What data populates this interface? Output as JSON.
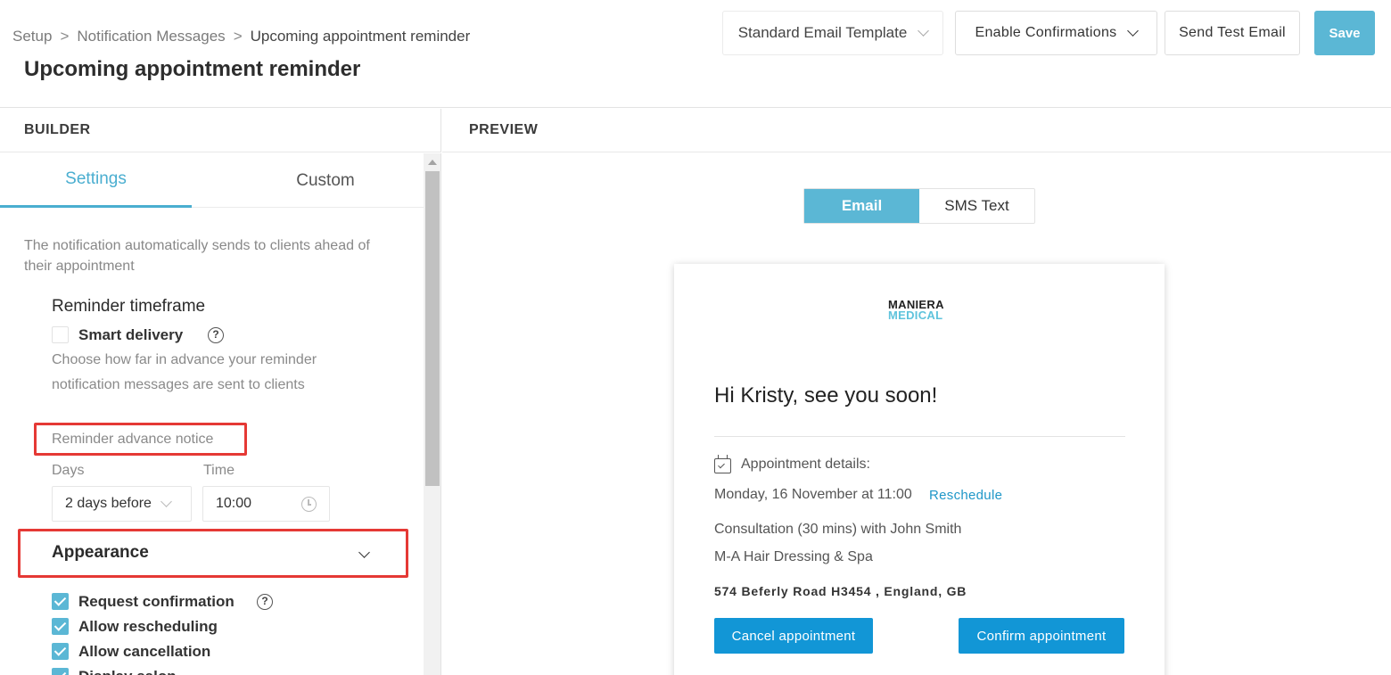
{
  "breadcrumb": {
    "items": [
      "Setup",
      "Notification Messages",
      "Upcoming appointment reminder"
    ],
    "separator": ">"
  },
  "page_title": "Upcoming appointment reminder",
  "header_actions": {
    "template_select": "Standard Email Template",
    "confirmations_select": "Enable Confirmations",
    "send_test": "Send Test Email",
    "save": "Save"
  },
  "sections": {
    "builder": "BUILDER",
    "preview": "PREVIEW"
  },
  "builder": {
    "tabs": [
      {
        "label": "Settings",
        "active": true
      },
      {
        "label": "Custom",
        "active": false
      }
    ],
    "description": "The notification automatically sends to clients ahead of their appointment",
    "timeframe_title": "Reminder timeframe",
    "smart_delivery": {
      "label": "Smart delivery",
      "checked": false
    },
    "hint": "Choose how far in advance your reminder notification messages are sent to clients",
    "advance_notice_label": "Reminder advance notice",
    "days": {
      "label": "Days",
      "value": "2 days before"
    },
    "time": {
      "label": "Time",
      "value": "10:00"
    },
    "appearance": {
      "label": "Appearance"
    },
    "options": [
      {
        "label": "Request confirmation",
        "checked": true,
        "help": true
      },
      {
        "label": "Allow rescheduling",
        "checked": true
      },
      {
        "label": "Allow cancellation",
        "checked": true
      },
      {
        "label": "Display salon",
        "checked": true
      }
    ]
  },
  "preview": {
    "toggle": [
      {
        "label": "Email",
        "active": true
      },
      {
        "label": "SMS Text",
        "active": false
      }
    ],
    "logo": {
      "line1": "MANIERA",
      "line2": "MEDICAL"
    },
    "greeting": "Hi Kristy, see you soon!",
    "appointment_heading": "Appointment details:",
    "datetime": "Monday, 16 November at 11:00",
    "reschedule": "Reschedule",
    "service": "Consultation (30 mins) with John Smith",
    "venue": "M-A Hair Dressing & Spa",
    "address": "574 Beferly Road H3454 , England, GB",
    "cancel_button": "Cancel appointment",
    "confirm_button": "Confirm appointment"
  },
  "colors": {
    "accent": "#5bb7d5",
    "highlight_box": "#e53935",
    "email_button": "#1296d6",
    "link": "#1f97c8"
  }
}
